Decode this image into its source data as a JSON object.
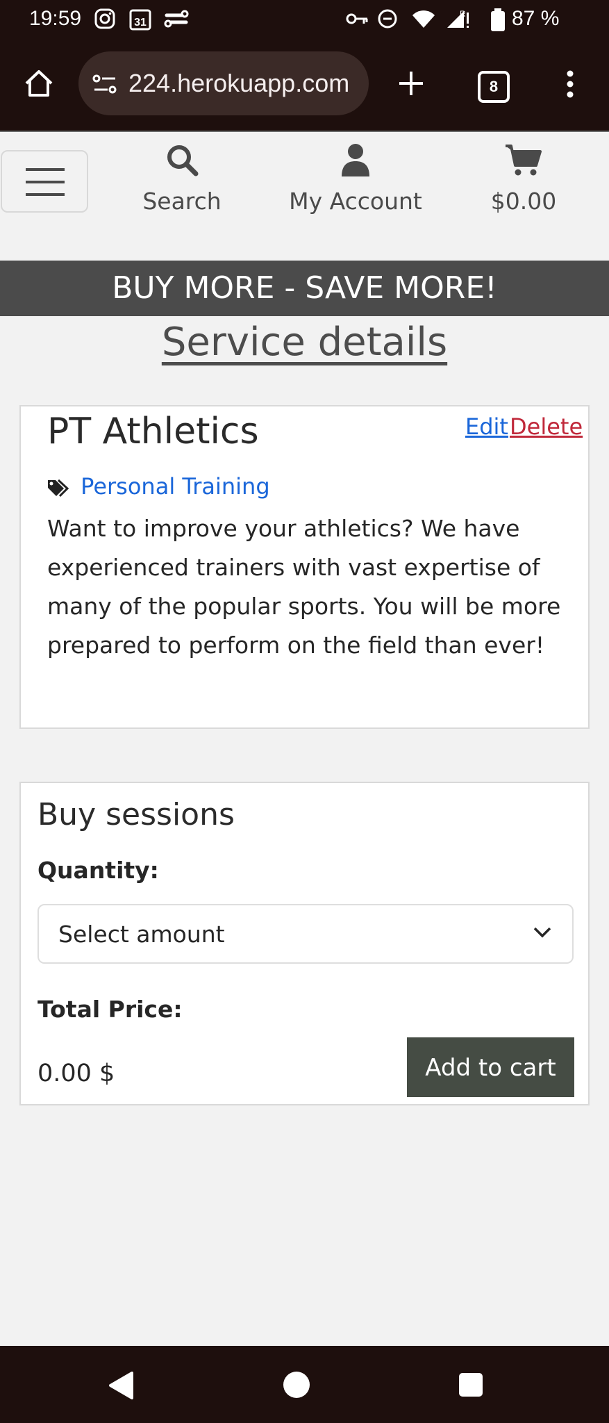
{
  "status_bar": {
    "time": "19:59",
    "battery": "87 %",
    "icons": [
      "instagram-icon",
      "calendar-icon",
      "link-icon",
      "vpn-key-icon",
      "dnd-icon",
      "wifi-icon",
      "signal-icon",
      "battery-icon"
    ],
    "calendar_day": "31"
  },
  "browser": {
    "url": "224.herokuapp.com",
    "tab_count": "8"
  },
  "nav": {
    "search_label": "Search",
    "account_label": "My Account",
    "cart_label": "$0.00"
  },
  "banner": "BUY MORE - SAVE MORE!",
  "page_title": "Service details",
  "service": {
    "name": "PT Athletics",
    "edit_label": "Edit",
    "delete_label": "Delete",
    "category": "Personal Training",
    "description": "Want to improve your athletics? We have experienced trainers with vast expertise of many of the popular sports. You will be more prepared to perform on the field than ever!"
  },
  "buy": {
    "heading": "Buy sessions",
    "quantity_label": "Quantity:",
    "quantity_value": "Select amount",
    "total_label": "Total Price:",
    "total_value": "0.00 $",
    "add_button": "Add to cart"
  },
  "colors": {
    "chrome_bg": "#1e0f0d",
    "banner_bg": "#4b4b4b",
    "link_blue": "#1a66d9",
    "delete_red": "#c0283a",
    "button_bg": "#454c44"
  }
}
